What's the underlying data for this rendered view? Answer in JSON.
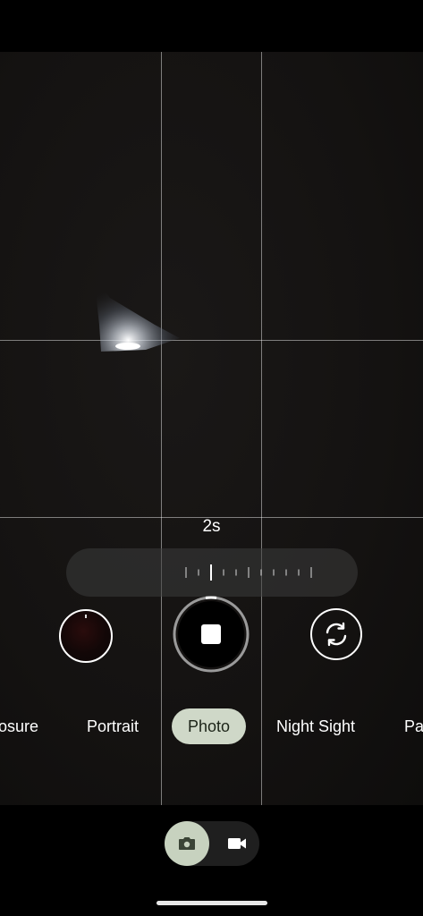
{
  "exposure": {
    "value_label": "2s",
    "level": 0.2
  },
  "modes": {
    "items": [
      {
        "label": "osure"
      },
      {
        "label": "Portrait"
      },
      {
        "label": "Photo"
      },
      {
        "label": "Night Sight"
      },
      {
        "label": "Pa"
      }
    ],
    "active": "Photo"
  },
  "icons": {
    "switch_camera": "switch-camera-icon",
    "photo_mode": "camera-icon",
    "video_mode": "video-icon",
    "shutter": "stop-icon"
  },
  "colors": {
    "active_mode_bg": "#cfd8c8",
    "toggle_active_bg": "#c7d2bf"
  }
}
